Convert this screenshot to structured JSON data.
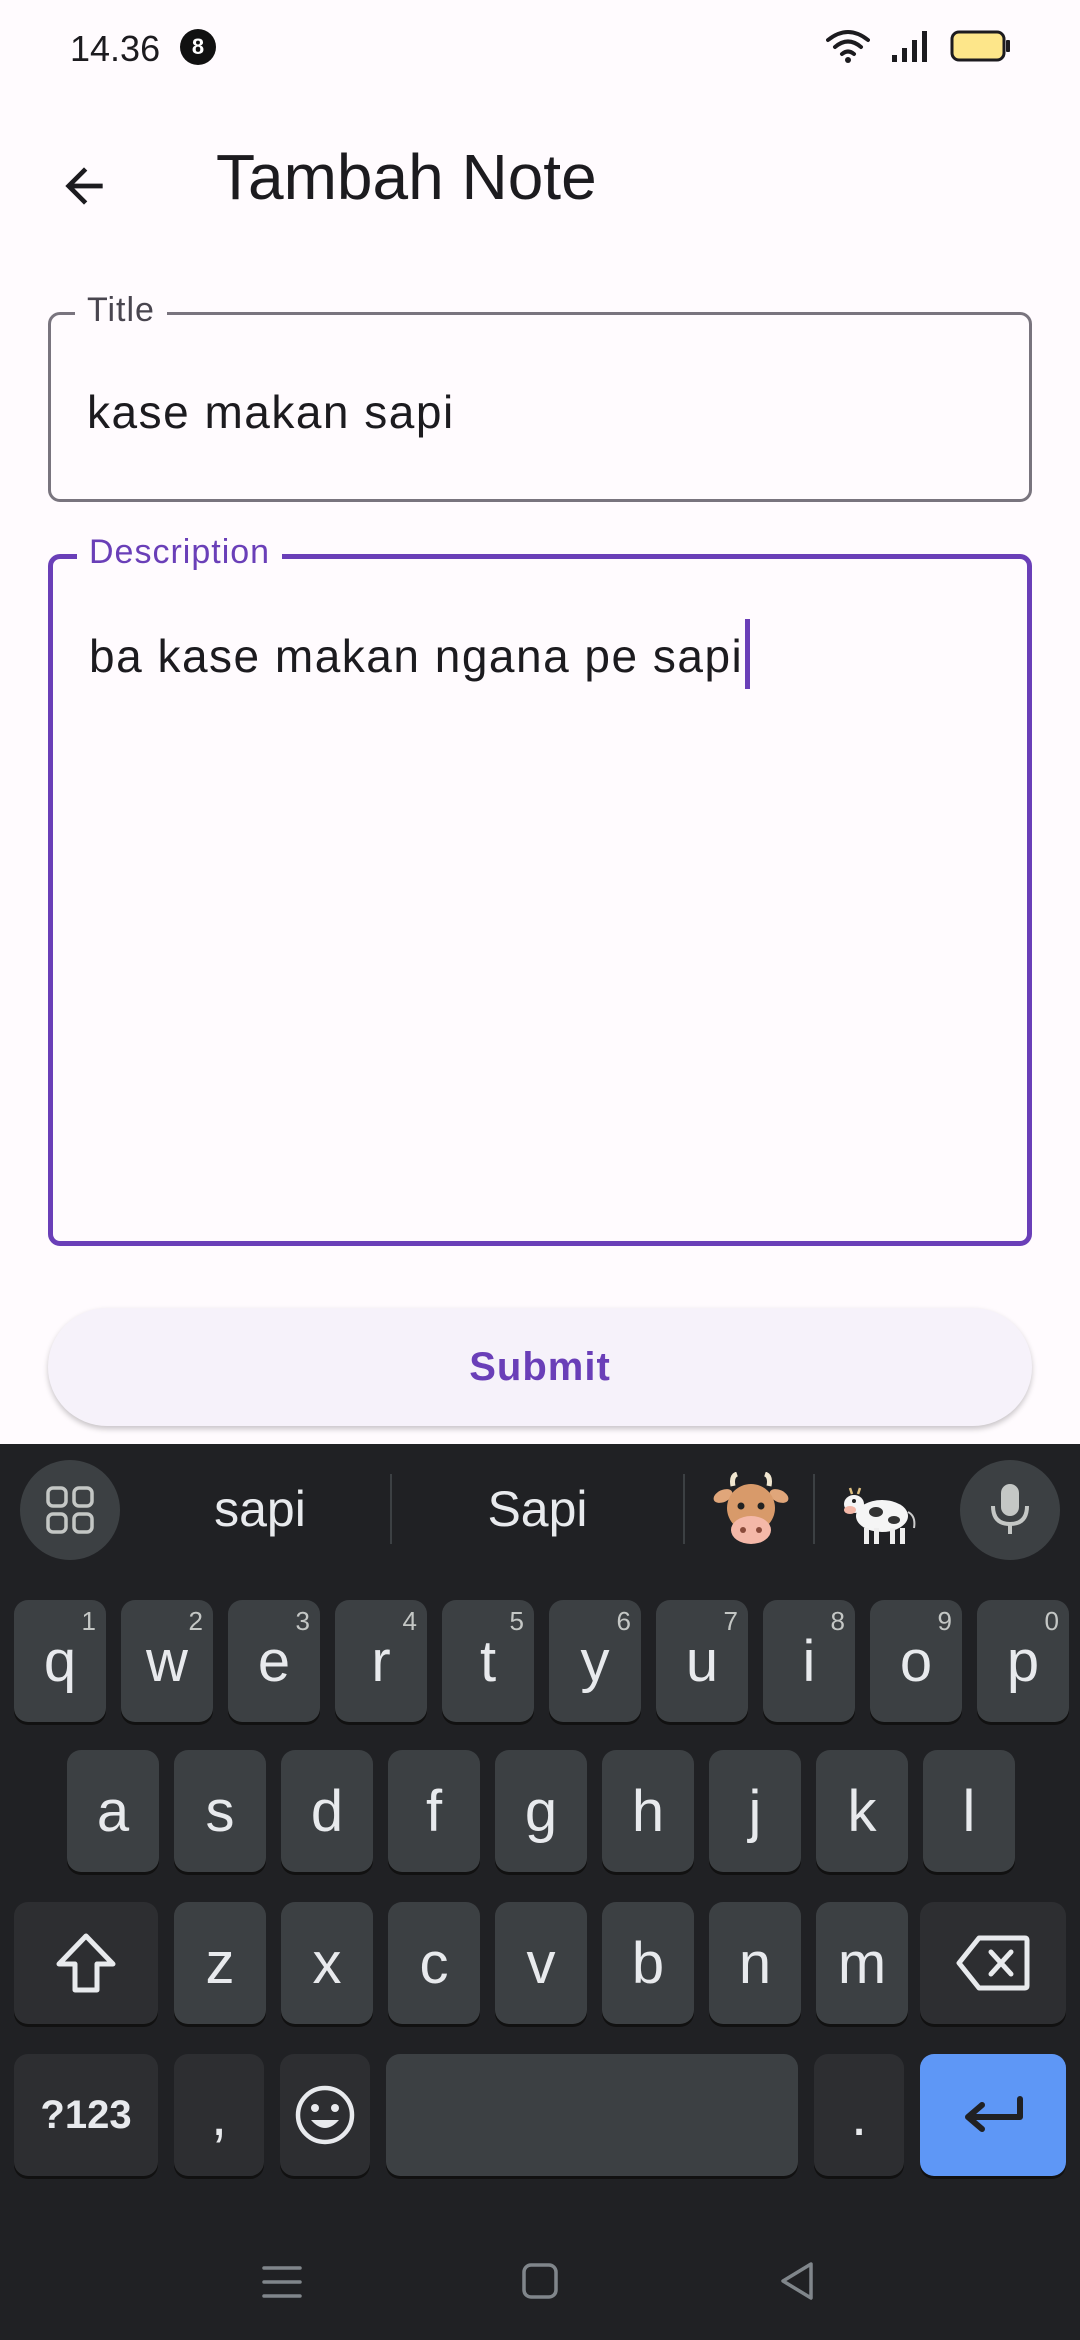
{
  "status_bar": {
    "time": "14.36",
    "notification_count": "8"
  },
  "app_bar": {
    "title": "Tambah Note"
  },
  "form": {
    "title_field": {
      "label": "Title",
      "value": "kase makan sapi"
    },
    "description_field": {
      "label": "Description",
      "value": "ba kase makan ngana pe sapi"
    },
    "submit_label": "Submit"
  },
  "keyboard": {
    "suggestions": [
      "sapi",
      "Sapi",
      "🐮",
      "🐄"
    ],
    "row1": [
      {
        "key": "q",
        "hint": "1"
      },
      {
        "key": "w",
        "hint": "2"
      },
      {
        "key": "e",
        "hint": "3"
      },
      {
        "key": "r",
        "hint": "4"
      },
      {
        "key": "t",
        "hint": "5"
      },
      {
        "key": "y",
        "hint": "6"
      },
      {
        "key": "u",
        "hint": "7"
      },
      {
        "key": "i",
        "hint": "8"
      },
      {
        "key": "o",
        "hint": "9"
      },
      {
        "key": "p",
        "hint": "0"
      }
    ],
    "row2": [
      "a",
      "s",
      "d",
      "f",
      "g",
      "h",
      "j",
      "k",
      "l"
    ],
    "row3": [
      "z",
      "x",
      "c",
      "v",
      "b",
      "n",
      "m"
    ],
    "row4": {
      "symbols": "?123",
      "comma": ",",
      "period": "."
    }
  },
  "colors": {
    "accent": "#6a3fb8",
    "keyboard_bg": "#202124",
    "key_bg": "#3c4043",
    "enter_key": "#5e97f6"
  }
}
